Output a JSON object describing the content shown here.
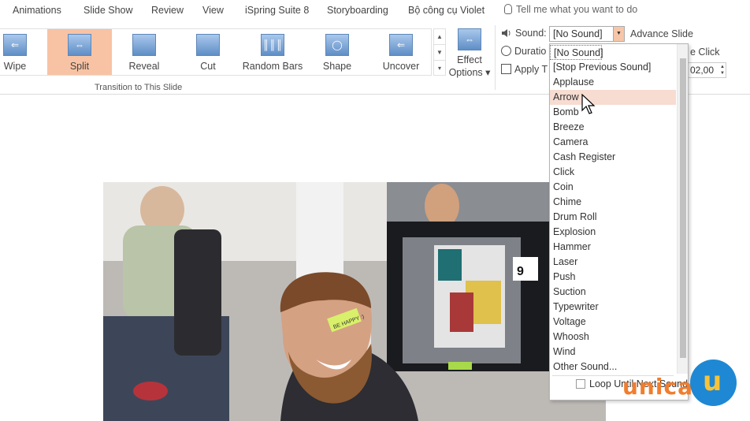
{
  "tabs": [
    "Animations",
    "Slide Show",
    "Review",
    "View",
    "iSpring Suite 8",
    "Storyboarding",
    "Bộ công cụ Violet"
  ],
  "tell_me": "Tell me what you want to do",
  "transitions": [
    {
      "label": "Wipe",
      "icon": "wipe-icon",
      "selected": false
    },
    {
      "label": "Split",
      "icon": "split-icon",
      "selected": true
    },
    {
      "label": "Reveal",
      "icon": "reveal-icon",
      "selected": false
    },
    {
      "label": "Cut",
      "icon": "cut-icon",
      "selected": false
    },
    {
      "label": "Random Bars",
      "icon": "random-bars-icon",
      "selected": false
    },
    {
      "label": "Shape",
      "icon": "shape-icon",
      "selected": false
    },
    {
      "label": "Uncover",
      "icon": "uncover-icon",
      "selected": false
    }
  ],
  "effect_options": {
    "line1": "Effect",
    "line2": "Options ▾"
  },
  "group_label": "Transition to This Slide",
  "timing": {
    "sound_label": "Sound:",
    "sound_value": "[No Sound]",
    "duration_label": "Duratio",
    "apply_label": "Apply T",
    "advance_slide": "Advance Slide",
    "on_click": "e Click",
    "after_value": "02,00"
  },
  "sound_options": [
    "[No Sound]",
    "[Stop Previous Sound]",
    "Applause",
    "Arrow",
    "Bomb",
    "Breeze",
    "Camera",
    "Cash Register",
    "Click",
    "Coin",
    "Chime",
    "Drum Roll",
    "Explosion",
    "Hammer",
    "Laser",
    "Push",
    "Suction",
    "Typewriter",
    "Voltage",
    "Whoosh",
    "Wind",
    "Other Sound..."
  ],
  "highlighted_option": "Arrow",
  "loop_label": "Loop Until Next Sound",
  "watermark": "unica",
  "photo_sticky_note": "BE HAPPY :)",
  "colors": {
    "selected_transition": "#f8c3a4",
    "highlight": "#f7dcd2",
    "brand_orange": "#f07e2e",
    "brand_blue": "#1e88d4"
  }
}
